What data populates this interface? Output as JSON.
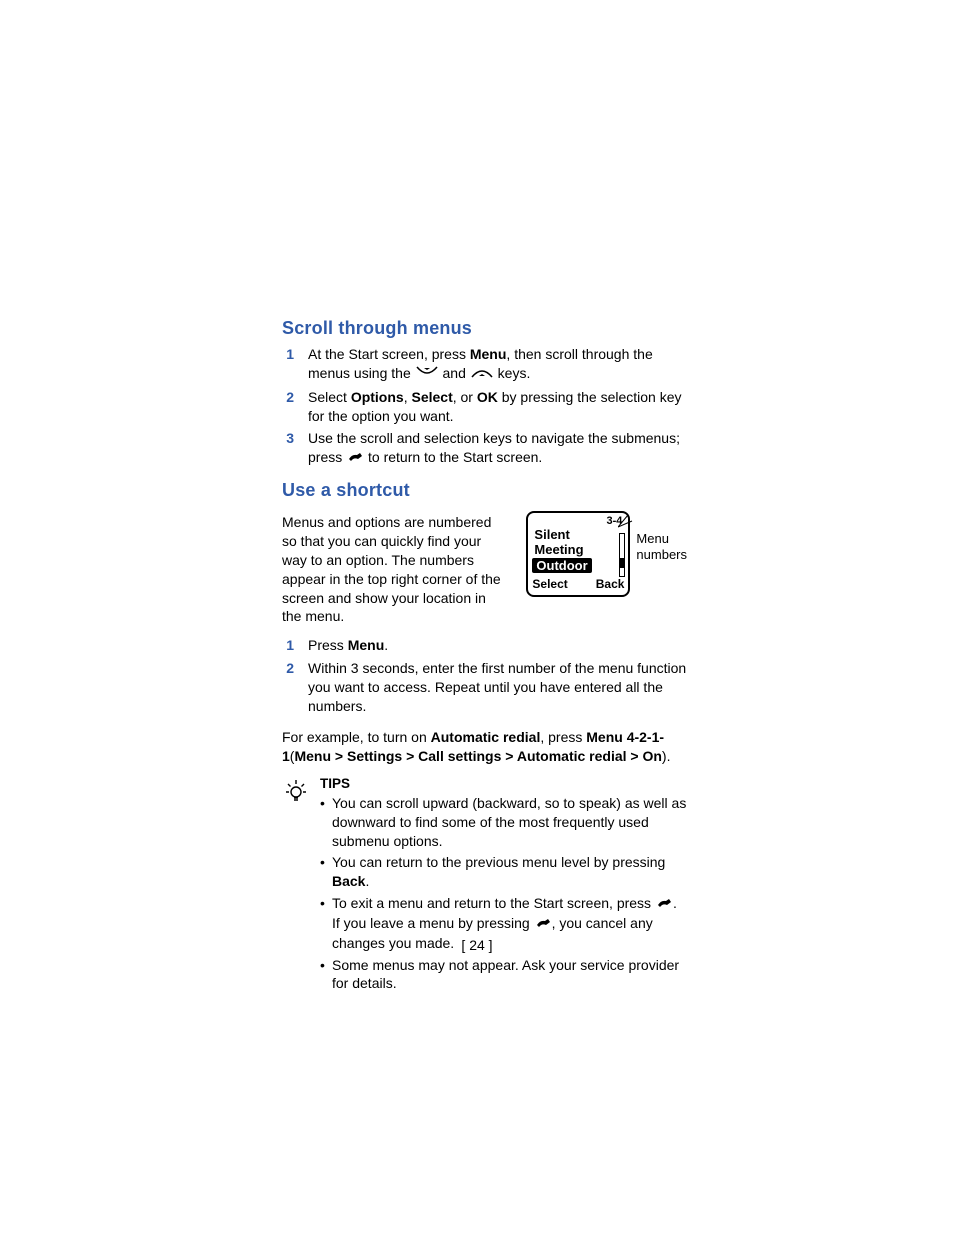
{
  "section1": {
    "heading": "Scroll through menus",
    "steps": [
      {
        "n": "1",
        "pre": "At the Start screen, press ",
        "bold1": "Menu",
        "post1": ", then scroll through the menus using the ",
        "mid": " and ",
        "post2": " keys."
      },
      {
        "n": "2",
        "pre": "Select ",
        "bold1": "Options",
        "sep1": ", ",
        "bold2": "Select",
        "sep2": ", or ",
        "bold3": "OK",
        "post": " by pressing the selection key for the option you want."
      },
      {
        "n": "3",
        "pre": "Use the scroll and selection keys to navigate the submenus; press ",
        "post": " to return to the Start screen."
      }
    ]
  },
  "section2": {
    "heading": "Use a shortcut",
    "intro": "Menus and options are numbered so that you can quickly find your way to an option. The numbers appear in the top right corner of the screen and show your location in the menu.",
    "phone": {
      "menunum": "3-4",
      "rows": [
        "Silent",
        "Meeting",
        "Outdoor"
      ],
      "soft_left": "Select",
      "soft_right": "Back"
    },
    "callout": {
      "l1": "Menu",
      "l2": "numbers"
    },
    "steps": [
      {
        "n": "1",
        "pre": "Press ",
        "bold": "Menu",
        "post": "."
      },
      {
        "n": "2",
        "text": "Within 3 seconds, enter the first number of the menu function you want to access. Repeat until you have entered all the numbers."
      }
    ],
    "example": {
      "pre": "For example, to turn on ",
      "b1": "Automatic redial",
      "mid": ", press ",
      "b2": "Menu 4-2-1-1",
      "open": "(",
      "b3": "Menu > Settings > Call settings > Automatic redial > On",
      "close": ")."
    }
  },
  "tips": {
    "title": "TIPS",
    "items": [
      {
        "text": "You can scroll upward (backward, so to speak) as well as downward to find some of the most frequently used submenu options."
      },
      {
        "pre": "You can return to the previous menu level by pressing ",
        "bold": "Back",
        "post": "."
      },
      {
        "pre": "To exit a menu and return to the Start screen, press ",
        "mid": ". If you leave a menu by pressing ",
        "post": ", you cancel any changes you made."
      },
      {
        "text": "Some menus may not appear. Ask your service provider for details."
      }
    ]
  },
  "page_number": "[ 24 ]"
}
